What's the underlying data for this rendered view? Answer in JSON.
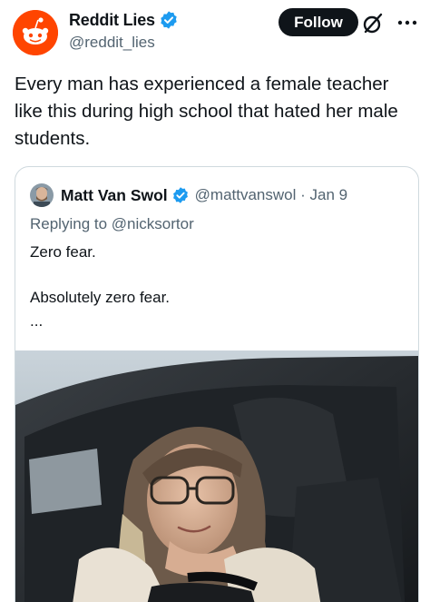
{
  "tweet": {
    "display_name": "Reddit Lies",
    "handle": "@reddit_lies",
    "follow_label": "Follow",
    "text": "Every man has experienced a female teacher like this during high school that hated her male students."
  },
  "quoted": {
    "display_name": "Matt Van Swol",
    "handle_date": "@mattvanswol · Jan 9",
    "replying_prefix": "Replying to",
    "replying_to": "@nicksortor",
    "line1": "Zero fear.",
    "line2": "Absolutely zero fear.",
    "truncation": "..."
  },
  "colors": {
    "reddit_orange": "#ff4500",
    "verified_blue": "#1d9bf0",
    "follow_bg": "#0f1419",
    "secondary_text": "#536471"
  },
  "icons": {
    "verified": "verified-badge-icon",
    "grok": "grok-icon",
    "more": "more-icon"
  }
}
